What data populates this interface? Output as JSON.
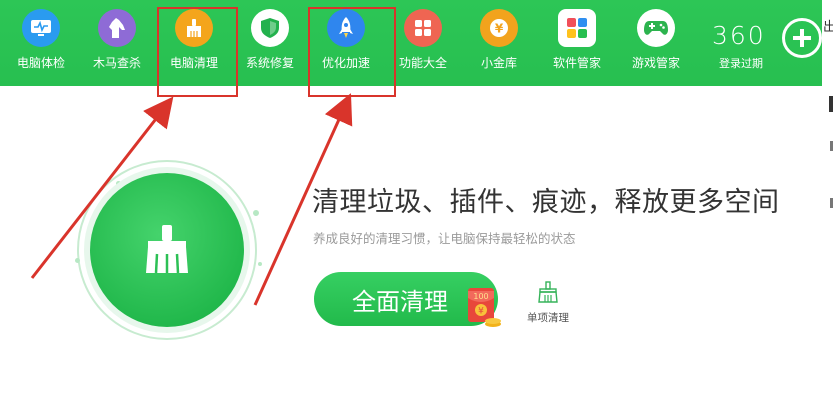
{
  "toolbar": {
    "items": [
      {
        "id": "checkup",
        "label": "电脑体检",
        "icon": "monitor-pulse-icon",
        "color": "#2a9bf0"
      },
      {
        "id": "trojan",
        "label": "木马查杀",
        "icon": "horse-icon",
        "color": "#8e6bd6"
      },
      {
        "id": "cleanup",
        "label": "电脑清理",
        "icon": "broom-icon",
        "color": "#f4a51c"
      },
      {
        "id": "repair",
        "label": "系统修复",
        "icon": "shield-icon",
        "color": "#23b14d"
      },
      {
        "id": "speedup",
        "label": "优化加速",
        "icon": "rocket-icon",
        "color": "#2f86ee"
      },
      {
        "id": "features",
        "label": "功能大全",
        "icon": "grid-icon",
        "color": "#ef6552"
      },
      {
        "id": "treasury",
        "label": "小金库",
        "icon": "coin-icon",
        "color": "#f2a31d"
      },
      {
        "id": "software",
        "label": "软件管家",
        "icon": "colorful-blocks-icon",
        "color": "#ffffff"
      },
      {
        "id": "games",
        "label": "游戏管家",
        "icon": "gamepad-icon",
        "color": "#2cb34e"
      }
    ],
    "brand": "360",
    "login_label": "登录过期",
    "bg_color": "#27bf50"
  },
  "main": {
    "headline": "清理垃圾、插件、痕迹，释放更多空间",
    "subline": "养成良好的清理习惯，让电脑保持最轻松的状态",
    "primary_button": "全面清理",
    "red_packet_amount": "100",
    "red_packet_symbol": "¥",
    "single_clean_label": "单项清理"
  },
  "annotations": {
    "highlight_color": "#d9342b",
    "highlighted_items": [
      "电脑清理",
      "优化加速"
    ]
  },
  "edge": {
    "top_char": "出"
  }
}
